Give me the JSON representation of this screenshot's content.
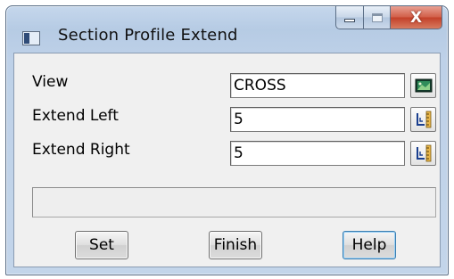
{
  "window": {
    "title": "Section Profile Extend",
    "caption_buttons": {
      "minimize": "minimize",
      "maximize": "maximize",
      "close": "X"
    }
  },
  "form": {
    "fields": [
      {
        "label": "View",
        "value": "CROSS",
        "icon": "view-select-icon"
      },
      {
        "label": "Extend Left",
        "value": "5",
        "icon": "pick-distance-icon"
      },
      {
        "label": "Extend Right",
        "value": "5",
        "icon": "pick-distance-icon"
      }
    ],
    "status_message": ""
  },
  "buttons": {
    "set": "Set",
    "finish": "Finish",
    "help": "Help"
  },
  "colors": {
    "title_bar": "#bed1e8",
    "close_button": "#c3412a",
    "client_bg": "#f0f0f0",
    "default_button_border": "#3c7fb1"
  }
}
